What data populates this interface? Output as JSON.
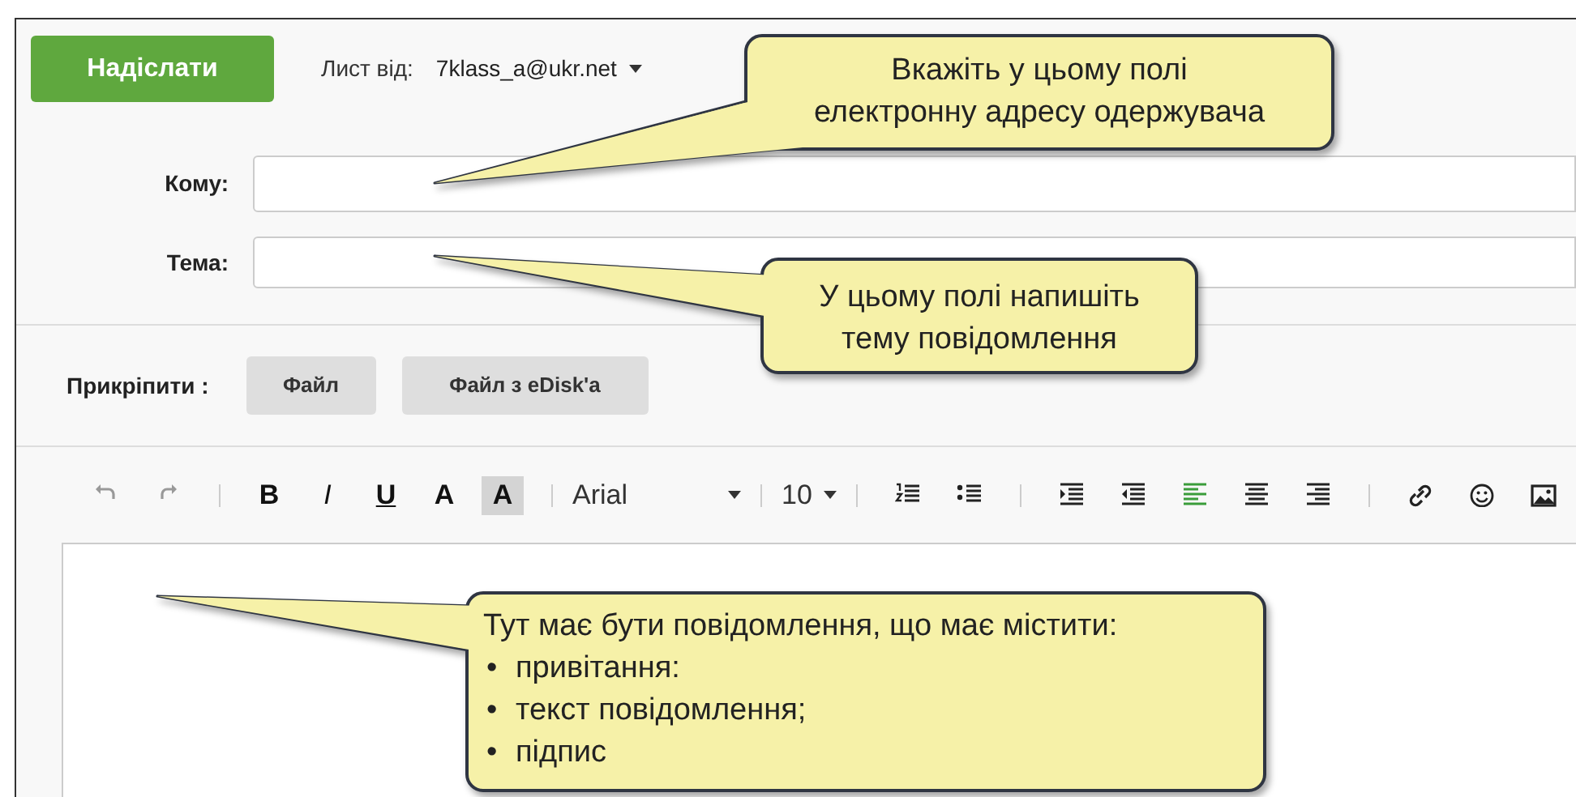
{
  "send_button": "Надіслати",
  "from": {
    "label": "Лист від:",
    "value": "7klass_a@ukr.net"
  },
  "fields": [
    {
      "label": "Кому:"
    },
    {
      "label": "Тема:"
    }
  ],
  "attach": {
    "label": "Прикріпити :",
    "buttons": [
      "Файл",
      "Файл з eDisk'a"
    ]
  },
  "toolbar": {
    "history": [
      {
        "kind": "undo"
      },
      {
        "kind": "redo"
      }
    ],
    "format": [
      {
        "kind": "bold",
        "label": "B"
      },
      {
        "kind": "italic",
        "label": "I"
      },
      {
        "kind": "underline",
        "label": "U"
      },
      {
        "kind": "text-color",
        "label": "A"
      },
      {
        "kind": "highlight",
        "label": "A"
      }
    ],
    "font": {
      "value": "Arial"
    },
    "size": {
      "value": "10"
    },
    "lists": [
      {
        "kind": "ordered"
      },
      {
        "kind": "bulleted"
      }
    ],
    "align": [
      {
        "kind": "indent",
        "selected": false
      },
      {
        "kind": "outdent",
        "selected": false
      },
      {
        "kind": "left",
        "selected": true
      },
      {
        "kind": "center",
        "selected": false
      },
      {
        "kind": "right",
        "selected": false
      }
    ],
    "insert": [
      {
        "kind": "link"
      },
      {
        "kind": "emoji"
      },
      {
        "kind": "image"
      }
    ]
  },
  "callouts": [
    {
      "lines": [
        "Вкажіть у цьому полі",
        "електронну адресу одержувача"
      ]
    },
    {
      "lines": [
        "У цьому полі напишіть",
        "тему повідомлення"
      ]
    },
    {
      "lines": [
        "Тут має бути повідомлення, що має містити:"
      ],
      "bullets": [
        {
          "bullet": "•",
          "text": "привітання:"
        },
        {
          "bullet": "•",
          "text": "текст повідомлення;"
        },
        {
          "bullet": "•",
          "text": "підпис"
        }
      ]
    }
  ]
}
